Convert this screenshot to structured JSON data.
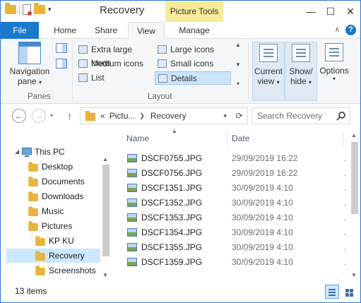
{
  "window": {
    "title": "Recovery",
    "context_tab_header": "Picture Tools",
    "controls": [
      "—",
      "☐",
      "✕"
    ]
  },
  "tabs": {
    "file": "File",
    "home": "Home",
    "share": "Share",
    "view": "View",
    "manage": "Manage"
  },
  "ribbon": {
    "panes": {
      "navigation_pane_line1": "Navigation",
      "navigation_pane_line2": "pane",
      "group_label": "Panes"
    },
    "layout": {
      "items": {
        "extra_large_icons": "Extra large icons",
        "large_icons": "Large icons",
        "medium_icons": "Medium icons",
        "small_icons": "Small icons",
        "list": "List",
        "details": "Details"
      },
      "selected": "Details",
      "group_label": "Layout"
    },
    "current_view": {
      "line1": "Current",
      "line2": "view"
    },
    "show_hide": {
      "line1": "Show/",
      "line2": "hide"
    },
    "options": {
      "label": "Options"
    }
  },
  "address": {
    "prefix": "«",
    "parent": "Pictu...",
    "current": "Recovery",
    "search_placeholder": "Search Recovery"
  },
  "nav_tree": {
    "this_pc": "This PC",
    "desktop": "Desktop",
    "documents": "Documents",
    "downloads": "Downloads",
    "music": "Music",
    "pictures": "Pictures",
    "kp_ku": "KP KU",
    "recovery": "Recovery",
    "screenshots": "Screenshots"
  },
  "filelist": {
    "columns": {
      "name": "Name",
      "date": "Date"
    },
    "rows": [
      {
        "name": "DSCF0755.JPG",
        "date": "29/09/2019 16:22"
      },
      {
        "name": "DSCF0756.JPG",
        "date": "29/09/2019 16:22"
      },
      {
        "name": "DSCF1351.JPG",
        "date": "30/09/2019 4:10"
      },
      {
        "name": "DSCF1352.JPG",
        "date": "30/09/2019 4:10"
      },
      {
        "name": "DSCF1353.JPG",
        "date": "30/09/2019 4:10"
      },
      {
        "name": "DSCF1354.JPG",
        "date": "30/09/2019 4:10"
      },
      {
        "name": "DSCF1355.JPG",
        "date": "30/09/2019 4:10"
      },
      {
        "name": "DSCF1359.JPG",
        "date": "30/09/2019 4:10"
      }
    ]
  },
  "status": {
    "item_count": "13 items"
  },
  "colors": {
    "accent": "#1979ca",
    "picture_tools": "#f7eb9a",
    "selection": "#cce8ff"
  }
}
